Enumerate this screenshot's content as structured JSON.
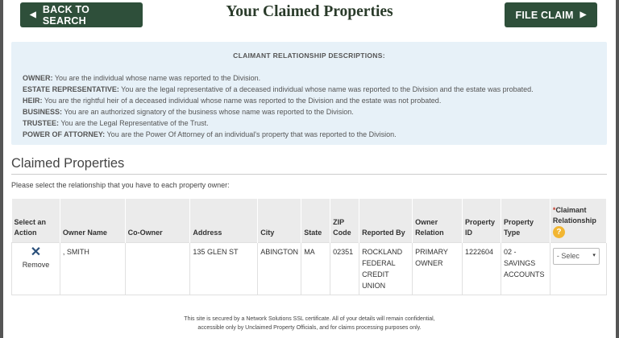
{
  "header": {
    "back_label": "BACK TO SEARCH",
    "title": "Your Claimed Properties",
    "file_claim_label": "FILE CLAIM"
  },
  "descriptions": {
    "title": "CLAIMANT RELATIONSHIP DESCRIPTIONS:",
    "items": [
      {
        "term": "OWNER:",
        "text": " You are the individual whose name was reported to the Division."
      },
      {
        "term": "ESTATE REPRESENTATIVE:",
        "text": " You are the legal representative of a deceased individual whose name was reported to the Division and the estate was probated."
      },
      {
        "term": "HEIR:",
        "text": " You are the rightful heir of a deceased individual whose name was reported to the Division and the estate was not probated."
      },
      {
        "term": "BUSINESS:",
        "text": " You are an authorized signatory of the business whose name was reported to the Division."
      },
      {
        "term": "TRUSTEE:",
        "text": " You are the Legal Representative of the Trust."
      },
      {
        "term": "POWER OF ATTORNEY:",
        "text": " You are the Power Of Attorney of an individual's property that was reported to the Division."
      }
    ]
  },
  "section": {
    "title": "Claimed Properties",
    "instructions": "Please select the relationship that you have to each property owner:"
  },
  "table": {
    "headers": {
      "action": "Select an Action",
      "owner": "Owner Name",
      "coowner": "Co-Owner",
      "address": "Address",
      "city": "City",
      "state": "State",
      "zip": "ZIP Code",
      "reported_by": "Reported By",
      "owner_relation": "Owner Relation",
      "property_id": "Property ID",
      "property_type": "Property Type",
      "claimant_required": "*",
      "claimant": "Claimant Relationship",
      "help": "?"
    },
    "row": {
      "remove_icon": "✕",
      "remove_label": "Remove",
      "owner": ", SMITH",
      "coowner": "",
      "address": "135 GLEN ST",
      "city": "ABINGTON",
      "state": "MA",
      "zip": "02351",
      "reported_by": "ROCKLAND FEDERAL CREDIT UNION",
      "owner_relation": "PRIMARY OWNER",
      "property_id": "1222604",
      "property_type": "02 - SAVINGS ACCOUNTS",
      "select_value": "- Selec",
      "select_caret": "▾"
    }
  },
  "footer": {
    "line1": "This site is secured by a Network Solutions SSL certificate. All of your details will remain confidential,",
    "line2": "accessible only by Unclaimed Property Officials, and for claims processing purposes only."
  },
  "icons": {
    "back": "triangle-left-icon",
    "file_claim": "triangle-right-icon",
    "remove": "close-icon",
    "help": "help-icon"
  },
  "colors": {
    "button_bg": "#2e4f3a",
    "desc_bg": "#e7f1f8",
    "help_badge": "#f2b632",
    "remove_icon": "#2a4f7a",
    "required_star": "#c0392b"
  }
}
